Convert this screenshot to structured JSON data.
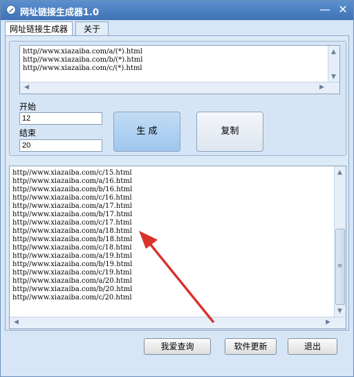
{
  "window": {
    "title": "网址链接生成器1.0",
    "minimize_glyph": "—",
    "close_glyph": "✕",
    "title_icon": "pencil-icon"
  },
  "tabs": [
    {
      "label": "网址链接生成器",
      "active": true
    },
    {
      "label": "关于",
      "active": false
    }
  ],
  "template_lines": [
    "http//www.xiazaiba.com/a/(*).html",
    "http//www.xiazaiba.com/b/(*).html",
    "http//www.xiazaiba.com/c/(*).html"
  ],
  "start": {
    "label": "开始",
    "value": "12"
  },
  "end": {
    "label": "结束",
    "value": "20"
  },
  "buttons": {
    "generate": "生 成",
    "copy": "复制",
    "query": "我爱查询",
    "update": "软件更新",
    "exit": "退出"
  },
  "output_lines": [
    "http//www.xiazaiba.com/c/15.html",
    "http//www.xiazaiba.com/a/16.html",
    "http//www.xiazaiba.com/b/16.html",
    "http//www.xiazaiba.com/c/16.html",
    "http//www.xiazaiba.com/a/17.html",
    "http//www.xiazaiba.com/b/17.html",
    "http//www.xiazaiba.com/c/17.html",
    "http//www.xiazaiba.com/a/18.html",
    "http//www.xiazaiba.com/b/18.html",
    "http//www.xiazaiba.com/c/18.html",
    "http//www.xiazaiba.com/a/19.html",
    "http//www.xiazaiba.com/b/19.html",
    "http//www.xiazaiba.com/c/19.html",
    "http//www.xiazaiba.com/a/20.html",
    "http//www.xiazaiba.com/b/20.html",
    "http//www.xiazaiba.com/c/20.html"
  ],
  "colors": {
    "annotation_arrow": "#d8322b",
    "generate_button": "#a9cdf0"
  }
}
